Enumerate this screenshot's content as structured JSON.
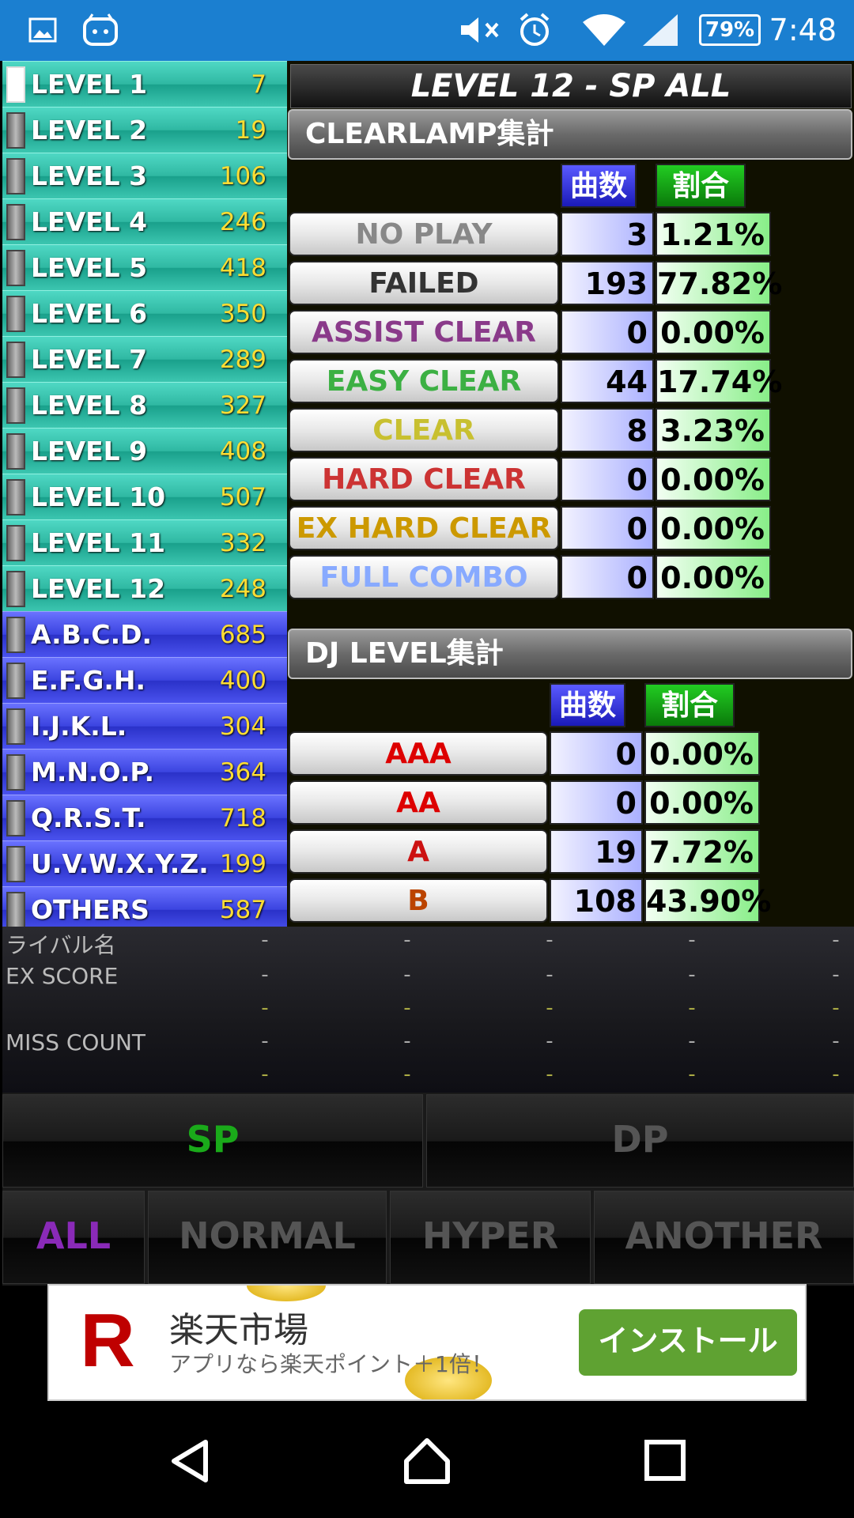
{
  "status_bar": {
    "time": "7:48",
    "battery": "79%",
    "icons": [
      "image-icon",
      "app-icon",
      "mute-icon",
      "alarm-icon",
      "wifi-icon",
      "signal-icon"
    ]
  },
  "levels": [
    {
      "label": "LEVEL 1",
      "count": "7",
      "group": "level"
    },
    {
      "label": "LEVEL 2",
      "count": "19",
      "group": "level"
    },
    {
      "label": "LEVEL 3",
      "count": "106",
      "group": "level"
    },
    {
      "label": "LEVEL 4",
      "count": "246",
      "group": "level"
    },
    {
      "label": "LEVEL 5",
      "count": "418",
      "group": "level"
    },
    {
      "label": "LEVEL 6",
      "count": "350",
      "group": "level"
    },
    {
      "label": "LEVEL 7",
      "count": "289",
      "group": "level"
    },
    {
      "label": "LEVEL 8",
      "count": "327",
      "group": "level"
    },
    {
      "label": "LEVEL 9",
      "count": "408",
      "group": "level"
    },
    {
      "label": "LEVEL 10",
      "count": "507",
      "group": "level"
    },
    {
      "label": "LEVEL 11",
      "count": "332",
      "group": "level"
    },
    {
      "label": "LEVEL 12",
      "count": "248",
      "group": "level"
    },
    {
      "label": "A.B.C.D.",
      "count": "685",
      "group": "alpha"
    },
    {
      "label": "E.F.G.H.",
      "count": "400",
      "group": "alpha"
    },
    {
      "label": "I.J.K.L.",
      "count": "304",
      "group": "alpha"
    },
    {
      "label": "M.N.O.P.",
      "count": "364",
      "group": "alpha"
    },
    {
      "label": "Q.R.S.T.",
      "count": "718",
      "group": "alpha"
    },
    {
      "label": "U.V.W.X.Y.Z.",
      "count": "199",
      "group": "alpha"
    },
    {
      "label": "OTHERS",
      "count": "587",
      "group": "alpha"
    }
  ],
  "panel_title": "LEVEL 12 - SP ALL",
  "clearlamp": {
    "header": "CLEARLAMP集計",
    "col_count": "曲数",
    "col_ratio": "割合",
    "rows": [
      {
        "label": "NO PLAY",
        "count": "3",
        "ratio": "1.21%",
        "color": "#888888"
      },
      {
        "label": "FAILED",
        "count": "193",
        "ratio": "77.82%",
        "color": "#333333"
      },
      {
        "label": "ASSIST CLEAR",
        "count": "0",
        "ratio": "0.00%",
        "color": "#8a3a8a"
      },
      {
        "label": "EASY CLEAR",
        "count": "44",
        "ratio": "17.74%",
        "color": "#3cb043"
      },
      {
        "label": "CLEAR",
        "count": "8",
        "ratio": "3.23%",
        "color": "#c8c030"
      },
      {
        "label": "HARD CLEAR",
        "count": "0",
        "ratio": "0.00%",
        "color": "#cc3333"
      },
      {
        "label": "EX HARD CLEAR",
        "count": "0",
        "ratio": "0.00%",
        "color": "#cc9900"
      },
      {
        "label": "FULL COMBO",
        "count": "0",
        "ratio": "0.00%",
        "color": "#88aaff"
      }
    ]
  },
  "djlevel": {
    "header": "DJ LEVEL集計",
    "col_count": "曲数",
    "col_ratio": "割合",
    "rows": [
      {
        "label": "AAA",
        "count": "0",
        "ratio": "0.00%",
        "color": "#dd0000"
      },
      {
        "label": "AA",
        "count": "0",
        "ratio": "0.00%",
        "color": "#dd0000"
      },
      {
        "label": "A",
        "count": "19",
        "ratio": "7.72%",
        "color": "#cc1111"
      },
      {
        "label": "B",
        "count": "108",
        "ratio": "43.90%",
        "color": "#bb4400"
      }
    ]
  },
  "rival": {
    "name_label": "ライバル名",
    "ex_label": "EX SCORE",
    "miss_label": "MISS COUNT",
    "dash": "-"
  },
  "modes": {
    "play": [
      {
        "label": "SP",
        "active": true
      },
      {
        "label": "DP",
        "active": false
      }
    ],
    "difficulty": [
      {
        "label": "ALL",
        "active": true
      },
      {
        "label": "NORMAL",
        "active": false
      },
      {
        "label": "HYPER",
        "active": false
      },
      {
        "label": "ANOTHER",
        "active": false
      }
    ]
  },
  "ad": {
    "logo": "R",
    "title": "楽天市場",
    "subtitle": "アプリなら楽天ポイント＋1倍！",
    "button": "インストール"
  }
}
